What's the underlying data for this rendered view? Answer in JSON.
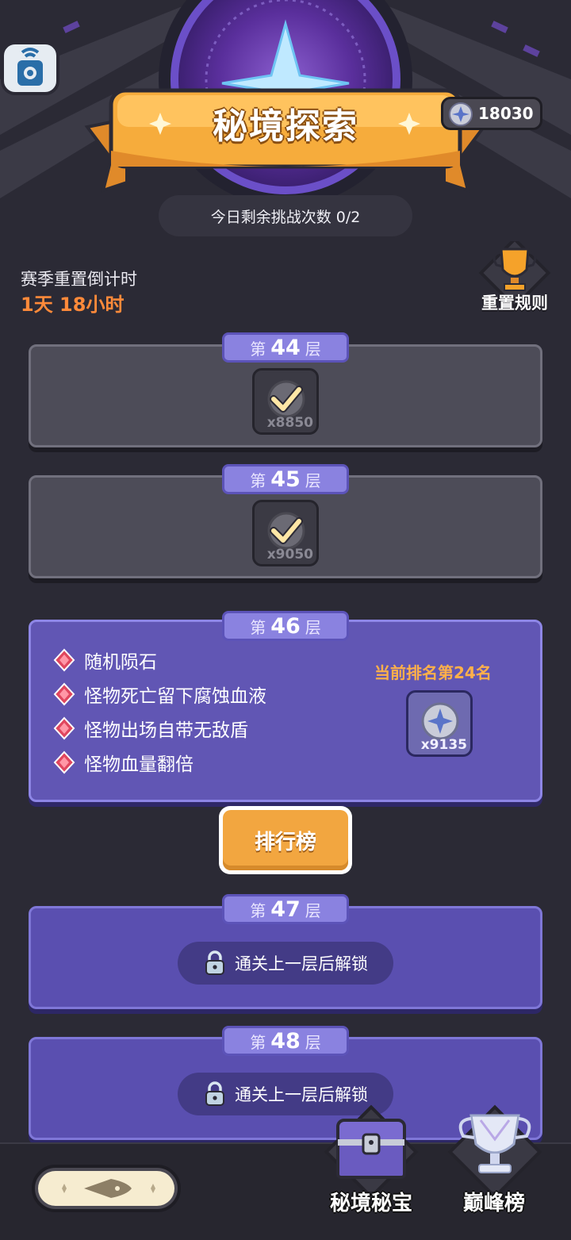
{
  "header": {
    "title": "秘境探索",
    "coins": "18030",
    "attempts_text": "今日剩余挑战次数 0/2"
  },
  "season": {
    "label": "赛季重置倒计时",
    "countdown": "1天 18小时",
    "rules_label": "重置规则"
  },
  "floors": [
    {
      "prefix": "第",
      "number": "44",
      "suffix": "层",
      "state": "cleared",
      "reward_qty": "x8850"
    },
    {
      "prefix": "第",
      "number": "45",
      "suffix": "层",
      "state": "cleared",
      "reward_qty": "x9050"
    },
    {
      "prefix": "第",
      "number": "46",
      "suffix": "层",
      "state": "current",
      "reward_qty": "x9135",
      "rank_text": "当前排名第24名",
      "modifiers": [
        "随机陨石",
        "怪物死亡留下腐蚀血液",
        "怪物出场自带无敌盾",
        "怪物血量翻倍"
      ]
    },
    {
      "prefix": "第",
      "number": "47",
      "suffix": "层",
      "state": "locked",
      "lock_text": "通关上一层后解锁"
    },
    {
      "prefix": "第",
      "number": "48",
      "suffix": "层",
      "state": "locked",
      "lock_text": "通关上一层后解锁"
    }
  ],
  "leaderboard_button": "排行榜",
  "bottom_nav": {
    "treasure_label": "秘境秘宝",
    "peak_label": "巅峰榜"
  },
  "colors": {
    "accent_orange": "#f2a640",
    "countdown": "#ff8a3a",
    "rank": "#ffb04a",
    "active_card": "#6156b4",
    "cleared_card": "#4d4c58"
  }
}
